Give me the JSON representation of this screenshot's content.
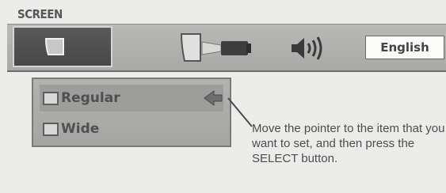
{
  "menu": {
    "title": "SCREEN"
  },
  "tabs": [
    {
      "name": "screen",
      "icon": "screen-icon",
      "selected": true
    },
    {
      "name": "projector",
      "icon": "projector-icon"
    },
    {
      "name": "sound",
      "icon": "speaker-icon"
    },
    {
      "name": "language",
      "label": "English"
    }
  ],
  "options": [
    {
      "label": "Regular",
      "selected": true
    },
    {
      "label": "Wide",
      "selected": false
    }
  ],
  "help_text": "Move the pointer to the item that you want to set, and then press the SELECT button.",
  "colors": {
    "background": "#ececea",
    "menubar": "#b0b0ae",
    "selected_tab": "#4f4f4f"
  }
}
